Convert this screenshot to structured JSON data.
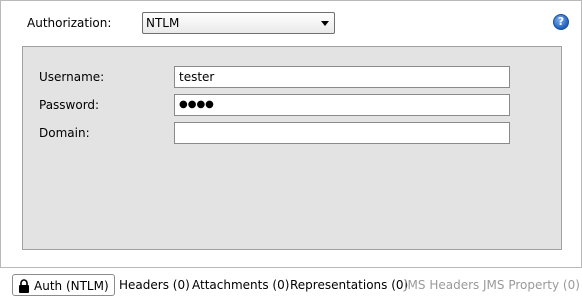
{
  "authorization": {
    "label": "Authorization:",
    "selected": "NTLM"
  },
  "help": {
    "glyph": "?"
  },
  "form": {
    "username_label": "Username:",
    "username_value": "tester",
    "password_label": "Password:",
    "password_masked": "●●●●",
    "domain_label": "Domain:",
    "domain_value": ""
  },
  "tabs": [
    {
      "label": "Auth (NTLM)",
      "active": true,
      "icon": "lock-icon"
    },
    {
      "label": "Headers (0)"
    },
    {
      "label": "Attachments (0)"
    },
    {
      "label": "Representations (0)"
    },
    {
      "label": "JMS Headers",
      "disabled": true
    },
    {
      "label": "JMS Property (0)",
      "disabled": true
    }
  ]
}
